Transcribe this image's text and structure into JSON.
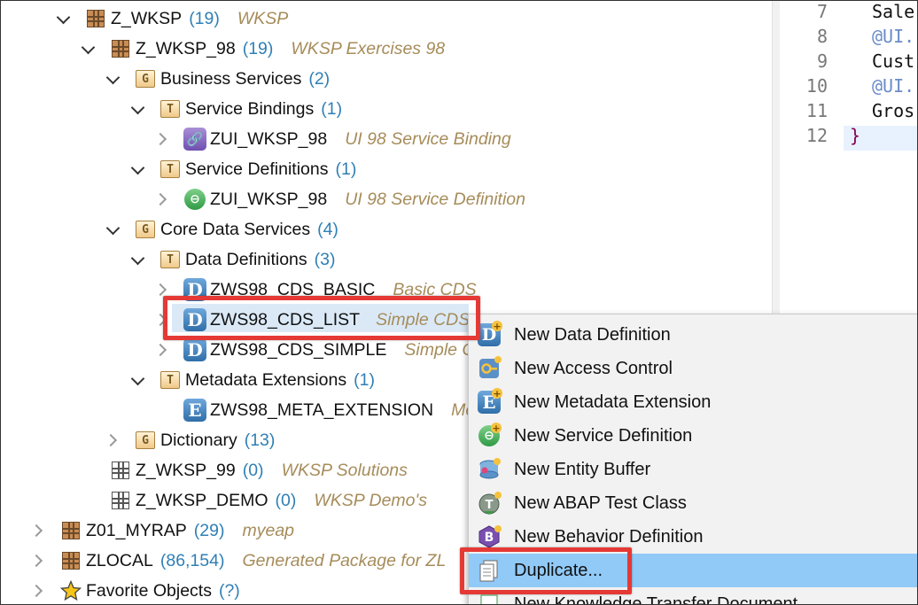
{
  "tree": [
    {
      "twisty": "open",
      "icon": "pkg",
      "label": "Z_WKSP",
      "count": "(19)",
      "desc": "WKSP"
    },
    {
      "twisty": "open",
      "icon": "pkg",
      "label": "Z_WKSP_98",
      "count": "(19)",
      "desc": "WKSP Exercises 98"
    },
    {
      "twisty": "open",
      "icon": "folder-g",
      "label": "Business Services",
      "count": "(2)",
      "desc": ""
    },
    {
      "twisty": "open",
      "icon": "folder-t",
      "label": "Service Bindings",
      "count": "(1)",
      "desc": ""
    },
    {
      "twisty": "closed",
      "icon": "binding",
      "label": "ZUI_WKSP_98",
      "count": "",
      "desc": "UI 98 Service Binding"
    },
    {
      "twisty": "open",
      "icon": "folder-t",
      "label": "Service Definitions",
      "count": "(1)",
      "desc": ""
    },
    {
      "twisty": "closed",
      "icon": "srvdef",
      "label": "ZUI_WKSP_98",
      "count": "",
      "desc": "UI 98 Service Definition"
    },
    {
      "twisty": "open",
      "icon": "folder-g",
      "label": "Core Data Services",
      "count": "(4)",
      "desc": ""
    },
    {
      "twisty": "open",
      "icon": "folder-t",
      "label": "Data Definitions",
      "count": "(3)",
      "desc": ""
    },
    {
      "twisty": "closed",
      "icon": "ddl",
      "label": "ZWS98_CDS_BASIC",
      "count": "",
      "desc": "Basic CDS"
    },
    {
      "twisty": "closed",
      "icon": "ddl",
      "label": "ZWS98_CDS_LIST",
      "count": "",
      "desc": "Simple CDS"
    },
    {
      "twisty": "closed",
      "icon": "ddl",
      "label": "ZWS98_CDS_SIMPLE",
      "count": "",
      "desc": "Simple CDS"
    },
    {
      "twisty": "open",
      "icon": "folder-t",
      "label": "Metadata Extensions",
      "count": "(1)",
      "desc": ""
    },
    {
      "twisty": "none",
      "icon": "ext",
      "label": "ZWS98_META_EXTENSION",
      "count": "",
      "desc": "Me"
    },
    {
      "twisty": "closed",
      "icon": "folder-g",
      "label": "Dictionary",
      "count": "(13)",
      "desc": ""
    },
    {
      "twisty": "none",
      "icon": "pkg-empty",
      "label": "Z_WKSP_99",
      "count": "(0)",
      "desc": "WKSP Solutions"
    },
    {
      "twisty": "none",
      "icon": "pkg-empty",
      "label": "Z_WKSP_DEMO",
      "count": "(0)",
      "desc": "WKSP Demo's"
    },
    {
      "twisty": "closed",
      "icon": "pkg",
      "label": "Z01_MYRAP",
      "count": "(29)",
      "desc": "myeap"
    },
    {
      "twisty": "closed",
      "icon": "pkg",
      "label": "ZLOCAL",
      "count": "(86,154)",
      "desc": "Generated Package for ZL"
    },
    {
      "twisty": "closed",
      "icon": "star",
      "label": "Favorite Objects",
      "count": "(?)",
      "desc": ""
    }
  ],
  "editor": {
    "lines": [
      {
        "no": "7",
        "text": "Sale",
        "kind": "plain"
      },
      {
        "no": "8",
        "text": "@UI.",
        "kind": "anno"
      },
      {
        "no": "9",
        "text": "Cust",
        "kind": "plain"
      },
      {
        "no": "10",
        "text": "@UI.",
        "kind": "anno"
      },
      {
        "no": "11",
        "text": "Gros",
        "kind": "plain"
      },
      {
        "no": "12",
        "text": "}",
        "kind": "brace"
      }
    ]
  },
  "context_menu": {
    "items": [
      {
        "label": "New Data Definition",
        "icon": "new-data-definition-icon"
      },
      {
        "label": "New Access Control",
        "icon": "new-access-control-icon"
      },
      {
        "label": "New Metadata Extension",
        "icon": "new-metadata-extension-icon"
      },
      {
        "label": "New Service Definition",
        "icon": "new-service-definition-icon"
      },
      {
        "label": "New Entity Buffer",
        "icon": "new-entity-buffer-icon"
      },
      {
        "label": "New ABAP Test Class",
        "icon": "new-abap-test-class-icon"
      },
      {
        "label": "New Behavior Definition",
        "icon": "new-behavior-definition-icon"
      },
      {
        "label": "Duplicate...",
        "icon": "duplicate-icon"
      },
      {
        "label": "New Knowledge Transfer Document",
        "icon": "new-ktd-icon"
      }
    ],
    "highlighted_index": 7
  },
  "colors": {
    "highlight_box": "#e53935",
    "count": "#2f7fb5",
    "description": "#a68c5a",
    "menu_hover": "#91c9f7"
  }
}
